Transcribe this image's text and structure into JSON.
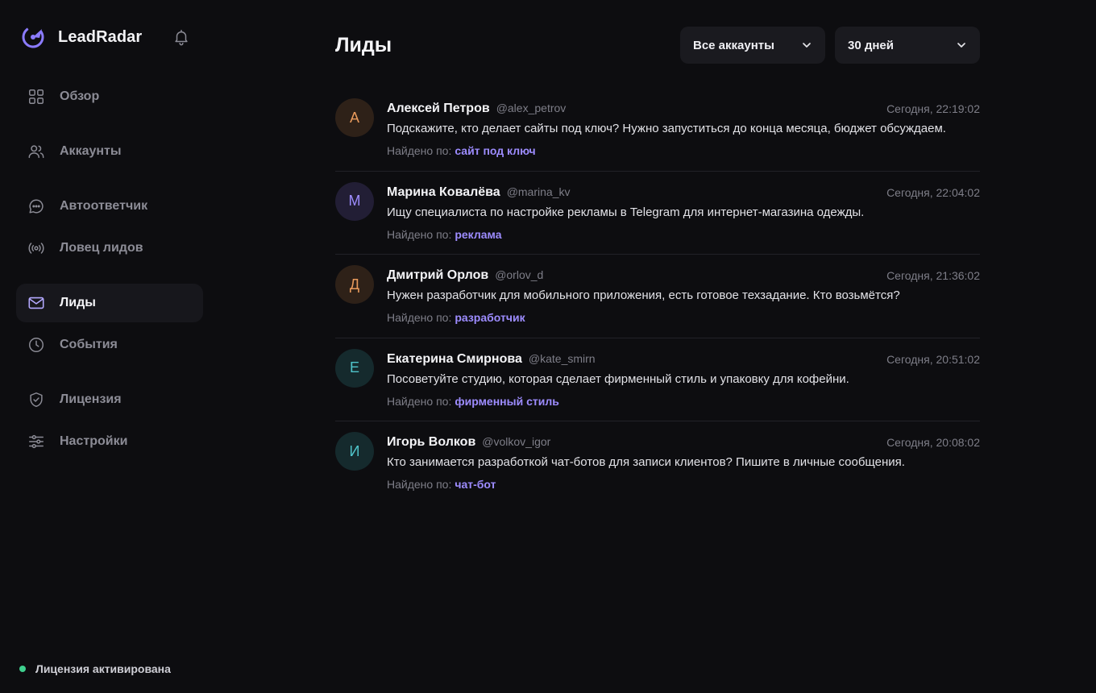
{
  "brand": {
    "name": "LeadRadar",
    "logo_icon": "radar-logo-icon",
    "accent": "#8b7bff"
  },
  "sidebar": {
    "items": [
      {
        "label": "Обзор",
        "icon": "grid-icon",
        "active": false
      },
      {
        "label": "Аккаунты",
        "icon": "users-icon",
        "active": false
      },
      {
        "label": "Автоответчик",
        "icon": "chat-icon",
        "active": false
      },
      {
        "label": "Ловец лидов",
        "icon": "broadcast-icon",
        "active": false
      },
      {
        "label": "Лиды",
        "icon": "mail-icon",
        "active": true
      },
      {
        "label": "События",
        "icon": "clock-icon",
        "active": false
      },
      {
        "label": "Лицензия",
        "icon": "shield-check-icon",
        "active": false
      },
      {
        "label": "Настройки",
        "icon": "sliders-icon",
        "active": false
      }
    ],
    "license_status": "Лицензия активирована",
    "license_status_color": "#3ecf8e"
  },
  "header": {
    "title": "Лиды",
    "account_filter": "Все аккаунты",
    "period_filter": "30 дней"
  },
  "leads": [
    {
      "initial": "А",
      "name": "Алексей Петров",
      "handle": "@alex_petrov",
      "time": "Сегодня, 22:19:02",
      "message": "Подскажите, кто делает сайты под ключ? Нужно запуститься до конца месяца, бюджет обсуждаем.",
      "found_label": "Найдено по:",
      "keyword": "сайт под ключ",
      "avatar_bg": "#2e2118",
      "avatar_fg": "#e89a5c"
    },
    {
      "initial": "М",
      "name": "Марина Ковалёва",
      "handle": "@marina_kv",
      "time": "Сегодня, 22:04:02",
      "message": "Ищу специалиста по настройке рекламы в Telegram для интернет-магазина одежды.",
      "found_label": "Найдено по:",
      "keyword": "реклама",
      "avatar_bg": "#221e35",
      "avatar_fg": "#9d8cff"
    },
    {
      "initial": "Д",
      "name": "Дмитрий Орлов",
      "handle": "@orlov_d",
      "time": "Сегодня, 21:36:02",
      "message": "Нужен разработчик для мобильного приложения, есть готовое техзадание. Кто возьмётся?",
      "found_label": "Найдено по:",
      "keyword": "разработчик",
      "avatar_bg": "#2e2118",
      "avatar_fg": "#e89a5c"
    },
    {
      "initial": "Е",
      "name": "Екатерина Смирнова",
      "handle": "@kate_smirn",
      "time": "Сегодня, 20:51:02",
      "message": "Посоветуйте студию, которая сделает фирменный стиль и упаковку для кофейни.",
      "found_label": "Найдено по:",
      "keyword": "фирменный стиль",
      "avatar_bg": "#152a2d",
      "avatar_fg": "#4fc3c9"
    },
    {
      "initial": "И",
      "name": "Игорь Волков",
      "handle": "@volkov_igor",
      "time": "Сегодня, 20:08:02",
      "message": "Кто занимается разработкой чат-ботов для записи клиентов? Пишите в личные сообщения.",
      "found_label": "Найдено по:",
      "keyword": "чат-бот",
      "avatar_bg": "#152a2d",
      "avatar_fg": "#4fc3c9"
    }
  ]
}
